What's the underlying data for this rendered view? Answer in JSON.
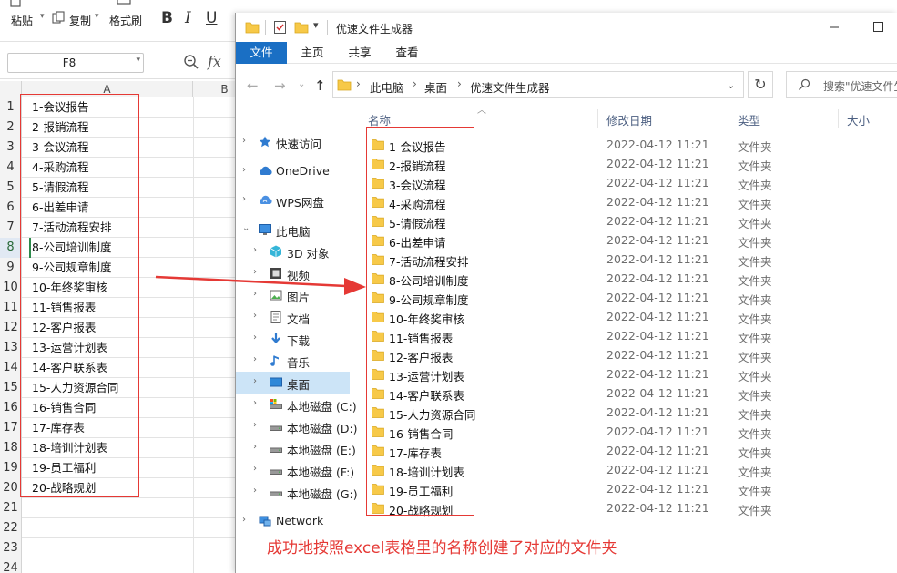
{
  "excel": {
    "ribbon": {
      "paste_label": "粘贴",
      "copy_label": "复制",
      "format_painter_label": "格式刷"
    },
    "name_box": "F8",
    "fx_label": "fx",
    "columns": [
      "A",
      "B"
    ],
    "active_row": 8,
    "rows": [
      {
        "num": "1",
        "a": "1-会议报告"
      },
      {
        "num": "2",
        "a": "2-报销流程"
      },
      {
        "num": "3",
        "a": "3-会议流程"
      },
      {
        "num": "4",
        "a": "4-采购流程"
      },
      {
        "num": "5",
        "a": "5-请假流程"
      },
      {
        "num": "6",
        "a": "6-出差申请"
      },
      {
        "num": "7",
        "a": "7-活动流程安排"
      },
      {
        "num": "8",
        "a": "8-公司培训制度"
      },
      {
        "num": "9",
        "a": "9-公司规章制度"
      },
      {
        "num": "10",
        "a": "10-年终奖审核"
      },
      {
        "num": "11",
        "a": "11-销售报表"
      },
      {
        "num": "12",
        "a": "12-客户报表"
      },
      {
        "num": "13",
        "a": "13-运营计划表"
      },
      {
        "num": "14",
        "a": "14-客户联系表"
      },
      {
        "num": "15",
        "a": "15-人力资源合同"
      },
      {
        "num": "16",
        "a": "16-销售合同"
      },
      {
        "num": "17",
        "a": "17-库存表"
      },
      {
        "num": "18",
        "a": "18-培训计划表"
      },
      {
        "num": "19",
        "a": "19-员工福利"
      },
      {
        "num": "20",
        "a": "20-战略规划"
      },
      {
        "num": "21",
        "a": ""
      },
      {
        "num": "22",
        "a": ""
      },
      {
        "num": "23",
        "a": ""
      },
      {
        "num": "24",
        "a": ""
      }
    ]
  },
  "explorer": {
    "title": "优速文件生成器",
    "menu": [
      "文件",
      "主页",
      "共享",
      "查看"
    ],
    "breadcrumb": [
      "此电脑",
      "桌面",
      "优速文件生成器"
    ],
    "search_placeholder": "搜索\"优速文件生",
    "nav": [
      {
        "label": "快速访问",
        "icon": "star-icon",
        "chev": "›",
        "indent": 0
      },
      {
        "label": "OneDrive",
        "icon": "cloud-icon",
        "chev": "›",
        "indent": 0
      },
      {
        "label": "WPS网盘",
        "icon": "wps-cloud-icon",
        "chev": "›",
        "indent": 0
      },
      {
        "label": "此电脑",
        "icon": "computer-icon",
        "chev": "⌄",
        "indent": 0
      },
      {
        "label": "3D 对象",
        "icon": "cube-icon",
        "chev": "›",
        "indent": 1
      },
      {
        "label": "视频",
        "icon": "video-icon",
        "chev": "›",
        "indent": 1
      },
      {
        "label": "图片",
        "icon": "picture-icon",
        "chev": "›",
        "indent": 1
      },
      {
        "label": "文档",
        "icon": "document-icon",
        "chev": "›",
        "indent": 1
      },
      {
        "label": "下载",
        "icon": "download-icon",
        "chev": "›",
        "indent": 1
      },
      {
        "label": "音乐",
        "icon": "music-icon",
        "chev": "›",
        "indent": 1
      },
      {
        "label": "桌面",
        "icon": "desktop-icon",
        "chev": "›",
        "indent": 1,
        "selected": true
      },
      {
        "label": "本地磁盘 (C:)",
        "icon": "system-drive-icon",
        "chev": "›",
        "indent": 1
      },
      {
        "label": "本地磁盘 (D:)",
        "icon": "drive-icon",
        "chev": "›",
        "indent": 1
      },
      {
        "label": "本地磁盘 (E:)",
        "icon": "drive-icon",
        "chev": "›",
        "indent": 1
      },
      {
        "label": "本地磁盘 (F:)",
        "icon": "drive-icon",
        "chev": "›",
        "indent": 1
      },
      {
        "label": "本地磁盘 (G:)",
        "icon": "drive-icon",
        "chev": "›",
        "indent": 1
      },
      {
        "label": "Network",
        "icon": "network-icon",
        "chev": "›",
        "indent": 0
      }
    ],
    "columns": {
      "name": "名称",
      "date": "修改日期",
      "type": "类型",
      "size": "大小"
    },
    "files": [
      {
        "name": "1-会议报告",
        "date": "2022-04-12 11:21",
        "type": "文件夹"
      },
      {
        "name": "2-报销流程",
        "date": "2022-04-12 11:21",
        "type": "文件夹"
      },
      {
        "name": "3-会议流程",
        "date": "2022-04-12 11:21",
        "type": "文件夹"
      },
      {
        "name": "4-采购流程",
        "date": "2022-04-12 11:21",
        "type": "文件夹"
      },
      {
        "name": "5-请假流程",
        "date": "2022-04-12 11:21",
        "type": "文件夹"
      },
      {
        "name": "6-出差申请",
        "date": "2022-04-12 11:21",
        "type": "文件夹"
      },
      {
        "name": "7-活动流程安排",
        "date": "2022-04-12 11:21",
        "type": "文件夹"
      },
      {
        "name": "8-公司培训制度",
        "date": "2022-04-12 11:21",
        "type": "文件夹"
      },
      {
        "name": "9-公司规章制度",
        "date": "2022-04-12 11:21",
        "type": "文件夹"
      },
      {
        "name": "10-年终奖审核",
        "date": "2022-04-12 11:21",
        "type": "文件夹"
      },
      {
        "name": "11-销售报表",
        "date": "2022-04-12 11:21",
        "type": "文件夹"
      },
      {
        "name": "12-客户报表",
        "date": "2022-04-12 11:21",
        "type": "文件夹"
      },
      {
        "name": "13-运营计划表",
        "date": "2022-04-12 11:21",
        "type": "文件夹"
      },
      {
        "name": "14-客户联系表",
        "date": "2022-04-12 11:21",
        "type": "文件夹"
      },
      {
        "name": "15-人力资源合同",
        "date": "2022-04-12 11:21",
        "type": "文件夹"
      },
      {
        "name": "16-销售合同",
        "date": "2022-04-12 11:21",
        "type": "文件夹"
      },
      {
        "name": "17-库存表",
        "date": "2022-04-12 11:21",
        "type": "文件夹"
      },
      {
        "name": "18-培训计划表",
        "date": "2022-04-12 11:21",
        "type": "文件夹"
      },
      {
        "name": "19-员工福利",
        "date": "2022-04-12 11:21",
        "type": "文件夹"
      },
      {
        "name": "20-战略规划",
        "date": "2022-04-12 11:21",
        "type": "文件夹"
      }
    ]
  },
  "annotation": {
    "caption": "成功地按照excel表格里的名称创建了对应的文件夹",
    "color": "#e53935"
  },
  "colors": {
    "folder": "#f7c948",
    "accent": "#1a6fc4",
    "nav_selected": "#cce4f7"
  }
}
